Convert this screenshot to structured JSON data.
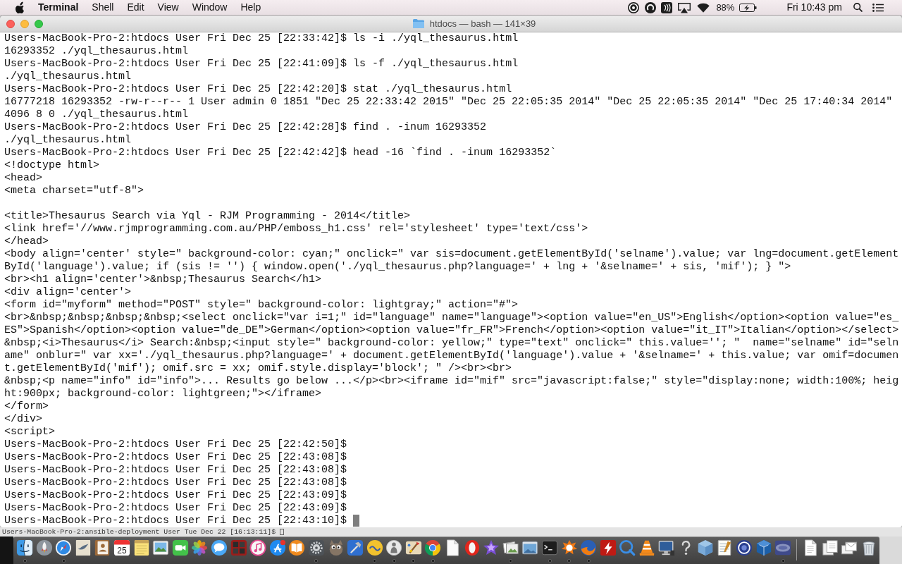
{
  "menu_bar": {
    "app_name": "Terminal",
    "menus": [
      "Shell",
      "Edit",
      "View",
      "Window",
      "Help"
    ],
    "battery_percent": "88%",
    "charging": true,
    "clock": "Fri 10:43 pm"
  },
  "window": {
    "title": "htdocs — bash — 141×39"
  },
  "terminal": {
    "lines": [
      {
        "kind": "prompt",
        "prompt": "Users-MacBook-Pro-2:htdocs User Fri Dec 25 [22:33:42]$",
        "command": "ls -i ./yql_thesaurus.html",
        "cursor": false
      },
      {
        "kind": "output",
        "text": "16293352 ./yql_thesaurus.html"
      },
      {
        "kind": "prompt",
        "prompt": "Users-MacBook-Pro-2:htdocs User Fri Dec 25 [22:41:09]$",
        "command": "ls -f ./yql_thesaurus.html",
        "cursor": false
      },
      {
        "kind": "output",
        "text": "./yql_thesaurus.html"
      },
      {
        "kind": "prompt",
        "prompt": "Users-MacBook-Pro-2:htdocs User Fri Dec 25 [22:42:20]$",
        "command": "stat ./yql_thesaurus.html",
        "cursor": false
      },
      {
        "kind": "output",
        "text": "16777218 16293352 -rw-r--r-- 1 User admin 0 1851 \"Dec 25 22:33:42 2015\" \"Dec 25 22:05:35 2014\" \"Dec 25 22:05:35 2014\" \"Dec 25 17:40:34 2014\""
      },
      {
        "kind": "output",
        "text": "4096 8 0 ./yql_thesaurus.html"
      },
      {
        "kind": "prompt",
        "prompt": "Users-MacBook-Pro-2:htdocs User Fri Dec 25 [22:42:28]$",
        "command": "find . -inum 16293352",
        "cursor": false
      },
      {
        "kind": "output",
        "text": "./yql_thesaurus.html"
      },
      {
        "kind": "prompt",
        "prompt": "Users-MacBook-Pro-2:htdocs User Fri Dec 25 [22:42:42]$",
        "command": "head -16 `find . -inum 16293352`",
        "cursor": false
      },
      {
        "kind": "output",
        "text": "<!doctype html>"
      },
      {
        "kind": "output",
        "text": "<head>"
      },
      {
        "kind": "output",
        "text": "<meta charset=\"utf-8\">"
      },
      {
        "kind": "blank"
      },
      {
        "kind": "output",
        "text": "<title>Thesaurus Search via Yql - RJM Programming - 2014</title>"
      },
      {
        "kind": "output",
        "text": "<link href='//www.rjmprogramming.com.au/PHP/emboss_h1.css' rel='stylesheet' type='text/css'>"
      },
      {
        "kind": "output",
        "text": "</head>"
      },
      {
        "kind": "output",
        "text": "<body align='center' style=\" background-color: cyan;\" onclick=\" var sis=document.getElementById('selname').value; var lng=document.getElement"
      },
      {
        "kind": "output",
        "text": "ById('language').value; if (sis != '') { window.open('./yql_thesaurus.php?language=' + lng + '&selname=' + sis, 'mif'); } \">"
      },
      {
        "kind": "output",
        "text": "<br><h1 align='center'>&nbsp;Thesaurus Search</h1>"
      },
      {
        "kind": "output",
        "text": "<div align='center'>"
      },
      {
        "kind": "output",
        "text": "<form id=\"myform\" method=\"POST\" style=\" background-color: lightgray;\" action=\"#\">"
      },
      {
        "kind": "output",
        "text": "<br>&nbsp;&nbsp;&nbsp;&nbsp;<select onclick=\"var i=1;\" id=\"language\" name=\"language\"><option value=\"en_US\">English</option><option value=\"es_"
      },
      {
        "kind": "output",
        "text": "ES\">Spanish</option><option value=\"de_DE\">German</option><option value=\"fr_FR\">French</option><option value=\"it_IT\">Italian</option></select>"
      },
      {
        "kind": "output",
        "text": "&nbsp;<i>Thesaurus</i> Search:&nbsp;<input style=\" background-color: yellow;\" type=\"text\" onclick=\" this.value=''; \"  name=\"selname\" id=\"seln"
      },
      {
        "kind": "output",
        "text": "ame\" onblur=\" var xx='./yql_thesaurus.php?language=' + document.getElementById('language').value + '&selname=' + this.value; var omif=documen"
      },
      {
        "kind": "output",
        "text": "t.getElementById('mif'); omif.src = xx; omif.style.display='block'; \" /><br><br>"
      },
      {
        "kind": "output",
        "text": "&nbsp;<p name=\"info\" id=\"info\">... Results go below ...</p><br><iframe id=\"mif\" src=\"javascript:false;\" style=\"display:none; width:100%; heig"
      },
      {
        "kind": "output",
        "text": "ht:900px; background-color: lightgreen;\"></iframe>"
      },
      {
        "kind": "output",
        "text": "</form>"
      },
      {
        "kind": "output",
        "text": "</div>"
      },
      {
        "kind": "output",
        "text": "<script>"
      },
      {
        "kind": "prompt",
        "prompt": "Users-MacBook-Pro-2:htdocs User Fri Dec 25 [22:42:50]$",
        "cursor": false
      },
      {
        "kind": "prompt",
        "prompt": "Users-MacBook-Pro-2:htdocs User Fri Dec 25 [22:43:08]$",
        "cursor": false
      },
      {
        "kind": "prompt",
        "prompt": "Users-MacBook-Pro-2:htdocs User Fri Dec 25 [22:43:08]$",
        "cursor": false
      },
      {
        "kind": "prompt",
        "prompt": "Users-MacBook-Pro-2:htdocs User Fri Dec 25 [22:43:08]$",
        "cursor": false
      },
      {
        "kind": "prompt",
        "prompt": "Users-MacBook-Pro-2:htdocs User Fri Dec 25 [22:43:09]$",
        "cursor": false
      },
      {
        "kind": "prompt",
        "prompt": "Users-MacBook-Pro-2:htdocs User Fri Dec 25 [22:43:09]$",
        "cursor": false
      },
      {
        "kind": "prompt",
        "prompt": "Users-MacBook-Pro-2:htdocs User Fri Dec 25 [22:43:10]$",
        "cursor": true
      }
    ]
  },
  "background_window": {
    "prompt": "Users-MacBook-Pro-2:ansible-deployment User Tue Dec 22 [16:13:11]$",
    "cursor": true
  },
  "dock": {
    "calendar_day": "25",
    "items": [
      {
        "running": true
      },
      {
        "running": false
      },
      {
        "running": true
      },
      {
        "running": false
      },
      {
        "running": false
      },
      {
        "running": false
      },
      {
        "running": false
      },
      {
        "running": false
      },
      {
        "running": false
      },
      {
        "running": false
      },
      {
        "running": false
      },
      {
        "running": false
      },
      {
        "running": false
      },
      {
        "running": false
      },
      {
        "running": false
      },
      {
        "running": true
      },
      {
        "running": false
      },
      {
        "running": false
      },
      {
        "running": true
      },
      {
        "running": true
      },
      {
        "running": true
      },
      {
        "running": true
      },
      {
        "running": false
      },
      {
        "running": false
      },
      {
        "running": false
      },
      {
        "running": true
      },
      {
        "running": false
      },
      {
        "running": true
      },
      {
        "running": true
      },
      {
        "running": true
      },
      {
        "running": false
      },
      {
        "running": false
      },
      {
        "running": false
      },
      {
        "running": false
      },
      {
        "running": false
      },
      {
        "running": false
      },
      {
        "running": false
      },
      {
        "running": false
      },
      {
        "running": false
      },
      {
        "running": true
      },
      {
        "running": false
      },
      {
        "running": false
      },
      {
        "running": false
      },
      {
        "running": false
      }
    ]
  }
}
